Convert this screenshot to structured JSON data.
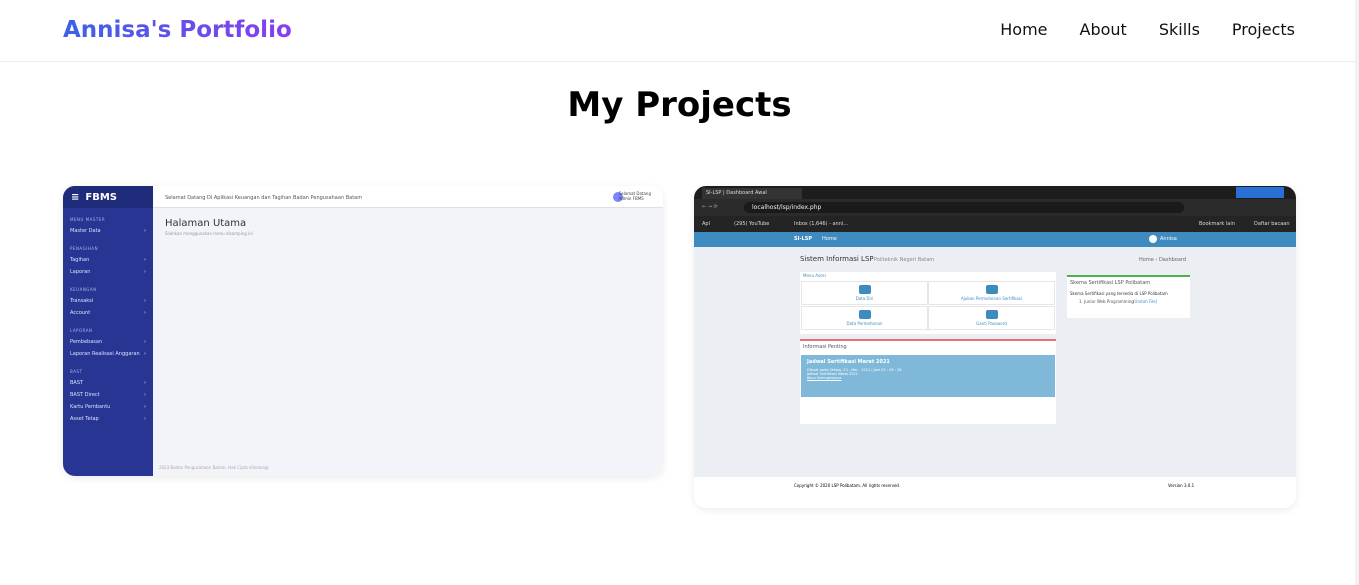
{
  "nav": {
    "logo": "Annisa's Portfolio",
    "links": [
      "Home",
      "About",
      "Skills",
      "Projects"
    ]
  },
  "page_title": "My Projects",
  "projects": [
    {
      "app": "FBMS",
      "header_text": "Selamat Datang Di Aplikasi Keuangan dan Tagihan Badan Pengusahaan Batam",
      "user_greeting": "Selamat Datang",
      "user_name": "Admin FBMS",
      "heading": "Halaman Utama",
      "subheading": "Silahkan menggunakan menu disamping ini",
      "sections": [
        {
          "label": "MENU MASTER",
          "items": [
            "Master Data"
          ]
        },
        {
          "label": "PENAGIHAN",
          "items": [
            "Tagihan",
            "Laporan"
          ]
        },
        {
          "label": "KEUANGAN",
          "items": [
            "Transaksi",
            "Account"
          ]
        },
        {
          "label": "LAPORAN",
          "items": [
            "Pembebasan",
            "Laporan Realisasi Anggaran"
          ]
        },
        {
          "label": "BAST",
          "items": [
            "BAST",
            "BAST Direct",
            "Kartu Pembantu",
            "Asset Tetap"
          ]
        }
      ],
      "footer": "2023 Badan Pengusahaan Batam. Hak Cipta dilindungi"
    },
    {
      "tab_title": "SI-LSP | Dashboard Awal",
      "url": "localhost/lsp/index.php",
      "bookmarks": [
        "Apl",
        "(295) YouTube",
        "Inbox (1,646) - anni...",
        "Bookmark lain",
        "Daftar bacaan"
      ],
      "brand": "SI-LSP",
      "nav_home": "Home",
      "user": "Annisa",
      "page_heading": "Sistem Informasi LSP",
      "page_sub": "Politeknik Negeri Batam",
      "breadcrumb": "Home › Dashboard",
      "menu_title": "Menu Asesi",
      "tiles": [
        "Data Diri",
        "Ajukan Permohonan Sertifikasi",
        "Data Permohonan",
        "Ganti Password"
      ],
      "info_title": "Informasi Penting",
      "info_heading": "Jadwal Sertifikasi Maret 2021",
      "info_lines": [
        "Dibuat pada Selasa, 23 - Mar - 2021 | Jam 02 : 08 : 26",
        "Jadwal Sertifikasi Maret 2021",
        "Baca Selengkapnya"
      ],
      "scheme_title": "Skema Sertifikasi LSP Polibatam",
      "scheme_text": "Skema Sertifikasi yang tersedia di LSP Polibatam",
      "scheme_item": "1. Junior Web Programming",
      "scheme_link": "(Unduh File)",
      "footer_left": "Copyright © 2020 LSP Polibatam. All rights reserved.",
      "footer_right": "Version 3.0.1"
    }
  ]
}
